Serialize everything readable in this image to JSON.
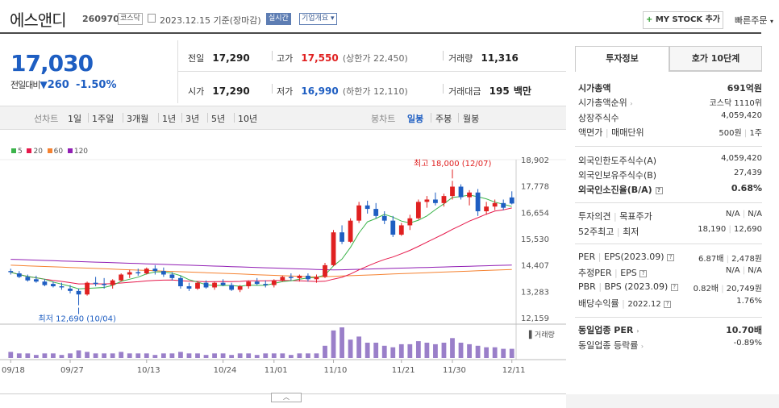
{
  "header": {
    "name": "에스앤디",
    "code": "260970",
    "market": "코스닥",
    "date_text": "2023.12.15 기준(장마감)",
    "realtime_label": "실시간",
    "company_info_label": "기업개요",
    "my_stock_label": "MY STOCK 추가",
    "quick_order_label": "빠른주문"
  },
  "quote": {
    "price": "17,030",
    "change_label": "전일대비",
    "change": "260",
    "change_pct": "-1.50%",
    "prev_close_label": "전일",
    "prev_close": "17,290",
    "high_label": "고가",
    "high": "17,550",
    "upper_limit": "(상한가 22,450)",
    "volume_label": "거래량",
    "volume": "11,316",
    "open_label": "시가",
    "open": "17,290",
    "low_label": "저가",
    "low": "16,990",
    "lower_limit": "(하한가 12,110)",
    "amount_label": "거래대금",
    "amount": "195",
    "amount_unit": "백만"
  },
  "period_tabs": {
    "label": "선차트",
    "items": [
      "1일",
      "1주일",
      "3개월",
      "1년",
      "3년",
      "5년",
      "10년"
    ]
  },
  "candle_tabs": {
    "label": "봉차트",
    "items": [
      "일봉",
      "주봉",
      "월봉"
    ],
    "active": "일봉"
  },
  "colors": {
    "up": "#e02020",
    "down": "#1e5ec2",
    "ma5": "#3cb44b",
    "ma20": "#e6194b",
    "ma60": "#f58231",
    "ma120": "#911eb4",
    "volume": "#9a7fc9"
  },
  "chart_data": {
    "type": "candlestick",
    "legend": [
      "5",
      "20",
      "60",
      "120"
    ],
    "y_ticks": [
      "18,902",
      "17,778",
      "16,654",
      "15,530",
      "14,407",
      "13,283",
      "12,159"
    ],
    "ylim": [
      12159,
      18902
    ],
    "x_ticks": [
      "09/18",
      "09/27",
      "10/13",
      "10/24",
      "11/01",
      "11/10",
      "11/21",
      "11/30",
      "12/11"
    ],
    "high_annotation": "최고 18,000 (12/07)",
    "low_annotation": "최저 12,690 (10/04)",
    "volume_label": "거래량",
    "candles": [
      [
        14150,
        14250,
        14000,
        14100
      ],
      [
        14050,
        14150,
        13850,
        13900
      ],
      [
        13900,
        14000,
        13700,
        13750
      ],
      [
        13800,
        13950,
        13650,
        13700
      ],
      [
        13700,
        13800,
        13500,
        13550
      ],
      [
        13600,
        13700,
        13450,
        13500
      ],
      [
        13500,
        13650,
        13350,
        13450
      ],
      [
        13400,
        13550,
        13200,
        13300
      ],
      [
        13300,
        13400,
        12690,
        13150
      ],
      [
        13150,
        13700,
        13100,
        13650
      ],
      [
        13650,
        13900,
        13500,
        13600
      ],
      [
        13600,
        13850,
        13400,
        13550
      ],
      [
        13550,
        13800,
        13400,
        13750
      ],
      [
        13750,
        14050,
        13700,
        14000
      ],
      [
        14000,
        14200,
        13850,
        14100
      ],
      [
        14100,
        14250,
        13950,
        14050
      ],
      [
        14050,
        14300,
        14000,
        14250
      ],
      [
        14250,
        14400,
        14000,
        14150
      ],
      [
        14150,
        14300,
        13900,
        14000
      ],
      [
        14000,
        14100,
        13750,
        13850
      ],
      [
        13850,
        13950,
        13400,
        13500
      ],
      [
        13500,
        13650,
        13300,
        13400
      ],
      [
        13400,
        13700,
        13350,
        13650
      ],
      [
        13650,
        13750,
        13400,
        13450
      ],
      [
        13450,
        13700,
        13350,
        13650
      ],
      [
        13650,
        13800,
        13500,
        13550
      ],
      [
        13550,
        13650,
        13300,
        13350
      ],
      [
        13350,
        13550,
        13250,
        13500
      ],
      [
        13500,
        13750,
        13400,
        13700
      ],
      [
        13700,
        13850,
        13550,
        13600
      ],
      [
        13600,
        13750,
        13450,
        13550
      ],
      [
        13550,
        13800,
        13450,
        13750
      ],
      [
        13750,
        13950,
        13700,
        13900
      ],
      [
        13900,
        14050,
        13750,
        13850
      ],
      [
        13850,
        14000,
        13700,
        13950
      ],
      [
        13950,
        14050,
        13700,
        13800
      ],
      [
        13800,
        14000,
        13650,
        13900
      ],
      [
        13900,
        14500,
        13850,
        14400
      ],
      [
        14400,
        15900,
        14350,
        15800
      ],
      [
        15800,
        16100,
        15300,
        15400
      ],
      [
        15400,
        16400,
        15350,
        16300
      ],
      [
        16300,
        17100,
        16200,
        16950
      ],
      [
        16950,
        17150,
        16600,
        16800
      ],
      [
        16800,
        17050,
        16400,
        16500
      ],
      [
        16500,
        16700,
        16150,
        16300
      ],
      [
        16300,
        16500,
        15600,
        15700
      ],
      [
        15700,
        16200,
        15650,
        16100
      ],
      [
        16100,
        16550,
        15900,
        16400
      ],
      [
        16400,
        17200,
        16350,
        17100
      ],
      [
        17100,
        17350,
        16850,
        17200
      ],
      [
        17200,
        17500,
        16950,
        17050
      ],
      [
        17050,
        17450,
        16900,
        17350
      ],
      [
        17350,
        18000,
        17200,
        17750
      ],
      [
        17750,
        17850,
        17200,
        17300
      ],
      [
        17300,
        17600,
        16950,
        17500
      ],
      [
        17500,
        17650,
        16500,
        16700
      ],
      [
        16700,
        17100,
        16550,
        16900
      ],
      [
        16900,
        17200,
        16750,
        17050
      ],
      [
        17050,
        17200,
        16750,
        16850
      ],
      [
        17290,
        17550,
        16990,
        17030
      ]
    ],
    "volume": [
      4,
      3,
      3,
      2,
      3,
      3,
      2,
      3,
      5,
      4,
      3,
      3,
      3,
      4,
      3,
      3,
      3,
      2,
      3,
      3,
      4,
      3,
      3,
      2,
      3,
      3,
      2,
      3,
      3,
      2,
      3,
      3,
      3,
      2,
      3,
      3,
      3,
      8,
      18,
      20,
      12,
      14,
      10,
      10,
      8,
      7,
      9,
      9,
      11,
      10,
      9,
      10,
      13,
      10,
      9,
      8,
      7,
      7,
      6,
      6
    ]
  },
  "side_panel": {
    "tabs": [
      "투자정보",
      "호가 10단계"
    ],
    "market_cap_label": "시가총액",
    "market_cap": "691억원",
    "market_cap_rank_label": "시가총액순위",
    "market_cap_rank": "코스닥 1110위",
    "shares_label": "상장주식수",
    "shares": "4,059,420",
    "par_label": "액면가",
    "trade_unit_label": "매매단위",
    "par_value": "500원",
    "trade_unit": "1주",
    "foreign_limit_label": "외국인한도주식수(A)",
    "foreign_limit": "4,059,420",
    "foreign_hold_label": "외국인보유주식수(B)",
    "foreign_hold": "27,439",
    "foreign_ratio_label": "외국인소진율(B/A)",
    "foreign_ratio": "0.68%",
    "opinion_label": "투자의견",
    "target_label": "목표주가",
    "opinion": "N/A",
    "target": "N/A",
    "w52_high_label": "52주최고",
    "w52_low_label": "최저",
    "w52_high": "18,190",
    "w52_low": "12,690",
    "per_label": "PER",
    "eps_label": "EPS(2023.09)",
    "per": "6.87배",
    "eps": "2,478원",
    "est_per_label": "추정PER",
    "est_eps_label": "EPS",
    "est_per": "N/A",
    "est_eps": "N/A",
    "pbr_label": "PBR",
    "bps_label": "BPS (2023.09)",
    "pbr": "0.82배",
    "bps": "20,749원",
    "dividend_label": "배당수익률",
    "dividend_date": "2022.12",
    "dividend": "1.76%",
    "industry_per_label": "동일업종 PER",
    "industry_per": "10.70배",
    "industry_change_label": "동일업종 등락률",
    "industry_change": "-0.89%"
  }
}
